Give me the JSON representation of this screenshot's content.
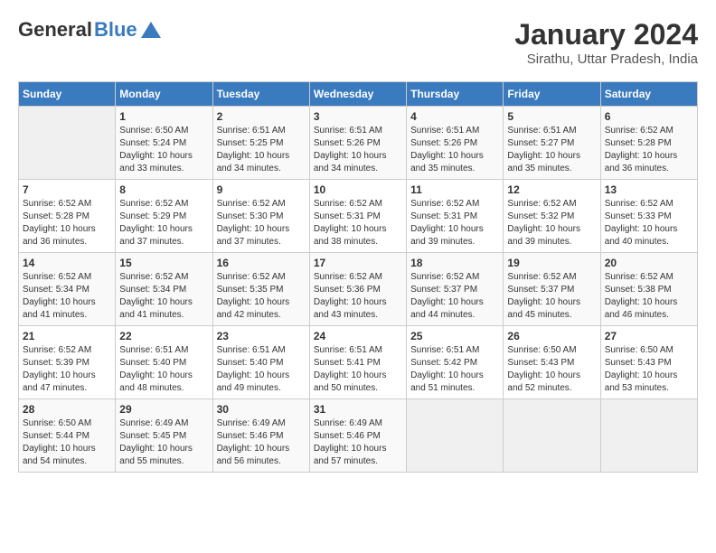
{
  "header": {
    "logo_general": "General",
    "logo_blue": "Blue",
    "month_year": "January 2024",
    "location": "Sirathu, Uttar Pradesh, India"
  },
  "days_of_week": [
    "Sunday",
    "Monday",
    "Tuesday",
    "Wednesday",
    "Thursday",
    "Friday",
    "Saturday"
  ],
  "weeks": [
    [
      {
        "day": "",
        "info": ""
      },
      {
        "day": "1",
        "info": "Sunrise: 6:50 AM\nSunset: 5:24 PM\nDaylight: 10 hours\nand 33 minutes."
      },
      {
        "day": "2",
        "info": "Sunrise: 6:51 AM\nSunset: 5:25 PM\nDaylight: 10 hours\nand 34 minutes."
      },
      {
        "day": "3",
        "info": "Sunrise: 6:51 AM\nSunset: 5:26 PM\nDaylight: 10 hours\nand 34 minutes."
      },
      {
        "day": "4",
        "info": "Sunrise: 6:51 AM\nSunset: 5:26 PM\nDaylight: 10 hours\nand 35 minutes."
      },
      {
        "day": "5",
        "info": "Sunrise: 6:51 AM\nSunset: 5:27 PM\nDaylight: 10 hours\nand 35 minutes."
      },
      {
        "day": "6",
        "info": "Sunrise: 6:52 AM\nSunset: 5:28 PM\nDaylight: 10 hours\nand 36 minutes."
      }
    ],
    [
      {
        "day": "7",
        "info": "Sunrise: 6:52 AM\nSunset: 5:28 PM\nDaylight: 10 hours\nand 36 minutes."
      },
      {
        "day": "8",
        "info": "Sunrise: 6:52 AM\nSunset: 5:29 PM\nDaylight: 10 hours\nand 37 minutes."
      },
      {
        "day": "9",
        "info": "Sunrise: 6:52 AM\nSunset: 5:30 PM\nDaylight: 10 hours\nand 37 minutes."
      },
      {
        "day": "10",
        "info": "Sunrise: 6:52 AM\nSunset: 5:31 PM\nDaylight: 10 hours\nand 38 minutes."
      },
      {
        "day": "11",
        "info": "Sunrise: 6:52 AM\nSunset: 5:31 PM\nDaylight: 10 hours\nand 39 minutes."
      },
      {
        "day": "12",
        "info": "Sunrise: 6:52 AM\nSunset: 5:32 PM\nDaylight: 10 hours\nand 39 minutes."
      },
      {
        "day": "13",
        "info": "Sunrise: 6:52 AM\nSunset: 5:33 PM\nDaylight: 10 hours\nand 40 minutes."
      }
    ],
    [
      {
        "day": "14",
        "info": "Sunrise: 6:52 AM\nSunset: 5:34 PM\nDaylight: 10 hours\nand 41 minutes."
      },
      {
        "day": "15",
        "info": "Sunrise: 6:52 AM\nSunset: 5:34 PM\nDaylight: 10 hours\nand 41 minutes."
      },
      {
        "day": "16",
        "info": "Sunrise: 6:52 AM\nSunset: 5:35 PM\nDaylight: 10 hours\nand 42 minutes."
      },
      {
        "day": "17",
        "info": "Sunrise: 6:52 AM\nSunset: 5:36 PM\nDaylight: 10 hours\nand 43 minutes."
      },
      {
        "day": "18",
        "info": "Sunrise: 6:52 AM\nSunset: 5:37 PM\nDaylight: 10 hours\nand 44 minutes."
      },
      {
        "day": "19",
        "info": "Sunrise: 6:52 AM\nSunset: 5:37 PM\nDaylight: 10 hours\nand 45 minutes."
      },
      {
        "day": "20",
        "info": "Sunrise: 6:52 AM\nSunset: 5:38 PM\nDaylight: 10 hours\nand 46 minutes."
      }
    ],
    [
      {
        "day": "21",
        "info": "Sunrise: 6:52 AM\nSunset: 5:39 PM\nDaylight: 10 hours\nand 47 minutes."
      },
      {
        "day": "22",
        "info": "Sunrise: 6:51 AM\nSunset: 5:40 PM\nDaylight: 10 hours\nand 48 minutes."
      },
      {
        "day": "23",
        "info": "Sunrise: 6:51 AM\nSunset: 5:40 PM\nDaylight: 10 hours\nand 49 minutes."
      },
      {
        "day": "24",
        "info": "Sunrise: 6:51 AM\nSunset: 5:41 PM\nDaylight: 10 hours\nand 50 minutes."
      },
      {
        "day": "25",
        "info": "Sunrise: 6:51 AM\nSunset: 5:42 PM\nDaylight: 10 hours\nand 51 minutes."
      },
      {
        "day": "26",
        "info": "Sunrise: 6:50 AM\nSunset: 5:43 PM\nDaylight: 10 hours\nand 52 minutes."
      },
      {
        "day": "27",
        "info": "Sunrise: 6:50 AM\nSunset: 5:43 PM\nDaylight: 10 hours\nand 53 minutes."
      }
    ],
    [
      {
        "day": "28",
        "info": "Sunrise: 6:50 AM\nSunset: 5:44 PM\nDaylight: 10 hours\nand 54 minutes."
      },
      {
        "day": "29",
        "info": "Sunrise: 6:49 AM\nSunset: 5:45 PM\nDaylight: 10 hours\nand 55 minutes."
      },
      {
        "day": "30",
        "info": "Sunrise: 6:49 AM\nSunset: 5:46 PM\nDaylight: 10 hours\nand 56 minutes."
      },
      {
        "day": "31",
        "info": "Sunrise: 6:49 AM\nSunset: 5:46 PM\nDaylight: 10 hours\nand 57 minutes."
      },
      {
        "day": "",
        "info": ""
      },
      {
        "day": "",
        "info": ""
      },
      {
        "day": "",
        "info": ""
      }
    ]
  ]
}
